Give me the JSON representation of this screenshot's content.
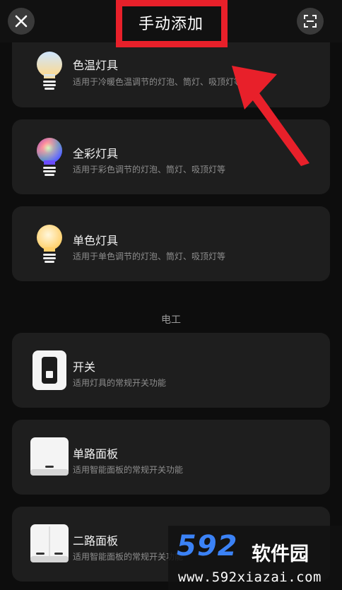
{
  "header": {
    "title": "手动添加",
    "close_icon": "close-icon",
    "scan_icon": "scan-icon"
  },
  "cards": [
    {
      "name": "色温灯具",
      "desc": "适用于冷暖色温调节的灯泡、筒灯、吸顶灯等",
      "icon": "tunable-bulb-icon"
    },
    {
      "name": "全彩灯具",
      "desc": "适用于彩色调节的灯泡、筒灯、吸顶灯等",
      "icon": "rgb-bulb-icon"
    },
    {
      "name": "单色灯具",
      "desc": "适用于单色调节的灯泡、筒灯、吸顶灯等",
      "icon": "mono-bulb-icon"
    },
    {
      "name": "开关",
      "desc": "适用灯具的常规开关功能",
      "icon": "switch-icon"
    },
    {
      "name": "单路面板",
      "desc": "适用智能面板的常规开关功能",
      "icon": "single-panel-icon"
    },
    {
      "name": "二路面板",
      "desc": "适用智能面板的常规开关功能",
      "icon": "double-panel-icon"
    }
  ],
  "section": {
    "label": "电工"
  },
  "watermark": {
    "brand": "592",
    "name": "软件园",
    "url": "www.592xiazai.com"
  },
  "colors": {
    "highlight": "#e8202a",
    "card_bg": "#1e1e1e",
    "watermark_blue": "#3b82f6"
  }
}
